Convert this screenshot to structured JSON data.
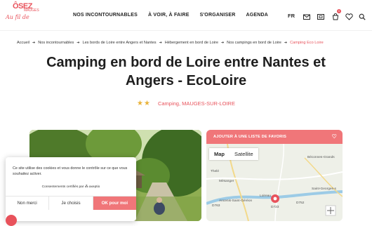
{
  "brand": {
    "word1": "ÔSEZ",
    "word2": "MAUGES",
    "tagline": "Au fil de"
  },
  "nav": {
    "items": [
      "NOS INCONTOURNABLES",
      "À VOIR, À FAIRE",
      "S'ORGANISER",
      "AGENDA"
    ],
    "lang": "FR",
    "cart_count": "0"
  },
  "breadcrumb": [
    "Accueil",
    "Nos incontournables",
    "Les bords de Loire entre Angers et Nantes",
    "Hébergement en bord de Loire",
    "Nos campings en bord de Loire",
    "Camping Eco Loire"
  ],
  "page": {
    "title": "Camping en bord de Loire entre Nantes et Angers - EcoLoire",
    "stars": "★★",
    "category": "Camping, MAUGES-SUR-LOIRE"
  },
  "map": {
    "favorite_label": "AJOUTER À UNE LISTE DE FAVORIS",
    "tab_map": "Map",
    "tab_satellite": "Satellite",
    "places": [
      "Béconnes-Grands",
      "Thelé",
      "Mésanger",
      "Saint-Georges-s",
      "Ancenis-Saint-Géréon",
      "Loireau",
      "D763",
      "D723",
      "D752"
    ]
  },
  "cookie": {
    "text": "Ce site utilise des cookies et vous donne le contrôle sur ce que vous souhaitez activer.",
    "powered": "Consentements certifiés par ⁂ axeptio",
    "btn_deny": "Non merci",
    "btn_choose": "Je choisis",
    "btn_ok": "OK pour moi"
  },
  "colors": {
    "accent": "#e8525b",
    "map_bar": "#f07679",
    "stars": "#e9b33a"
  }
}
